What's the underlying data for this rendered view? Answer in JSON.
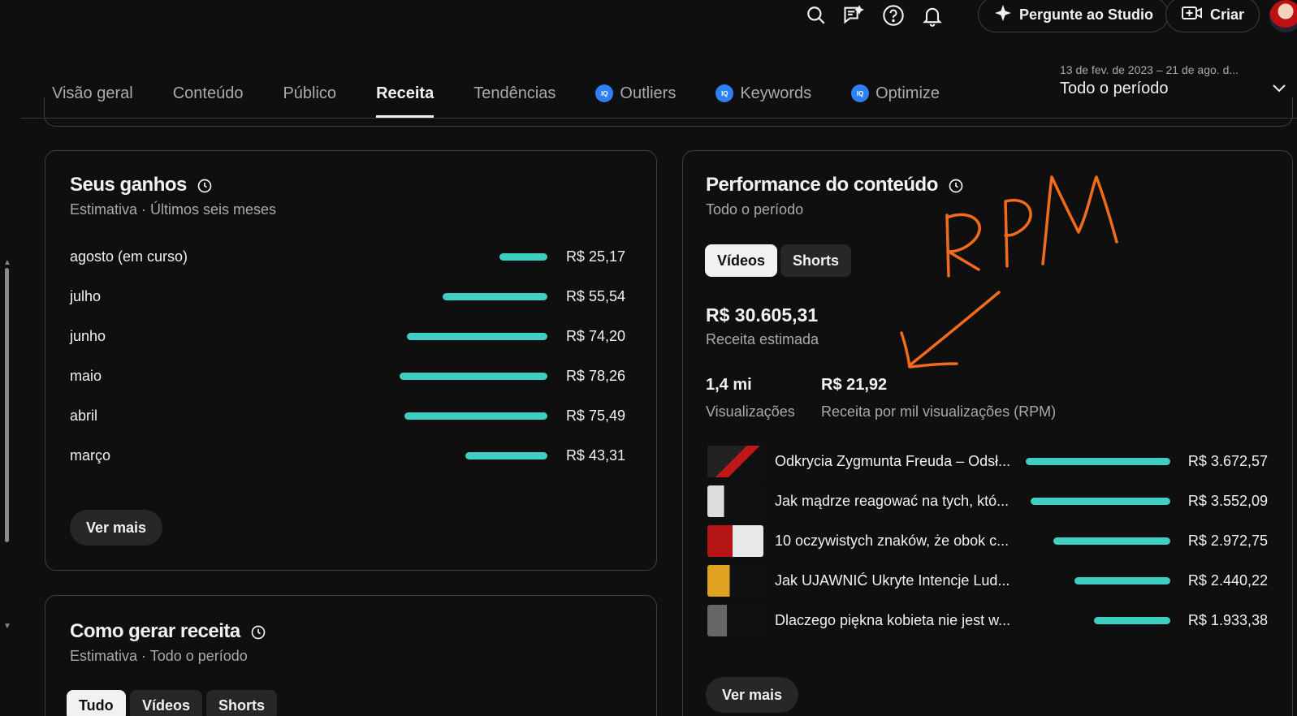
{
  "topbar": {
    "ask_studio_label": "Pergunte ao Studio",
    "create_label": "Criar"
  },
  "tabs": [
    {
      "label": "Visão geral"
    },
    {
      "label": "Conteúdo"
    },
    {
      "label": "Público"
    },
    {
      "label": "Receita",
      "active": true
    },
    {
      "label": "Tendências"
    },
    {
      "label": "Outliers",
      "badge": "IQ"
    },
    {
      "label": "Keywords",
      "badge": "IQ"
    },
    {
      "label": "Optimize",
      "badge": "IQ"
    }
  ],
  "date_range": {
    "range": "13 de fev. de 2023 – 21 de ago. d...",
    "period": "Todo o período"
  },
  "earnings": {
    "title": "Seus ganhos",
    "subtitle": "Estimativa · Últimos seis meses",
    "rows": [
      {
        "label": "agosto (em curso)",
        "value": "R$ 25,17",
        "amount": 25.17
      },
      {
        "label": "julho",
        "value": "R$ 55,54",
        "amount": 55.54
      },
      {
        "label": "junho",
        "value": "R$ 74,20",
        "amount": 74.2
      },
      {
        "label": "maio",
        "value": "R$ 78,26",
        "amount": 78.26
      },
      {
        "label": "abril",
        "value": "R$ 75,49",
        "amount": 75.49
      },
      {
        "label": "março",
        "value": "R$ 43,31",
        "amount": 43.31
      }
    ],
    "more_label": "Ver mais"
  },
  "how_to": {
    "title": "Como gerar receita",
    "subtitle": "Estimativa · Todo o período",
    "filters": [
      "Tudo",
      "Vídeos",
      "Shorts"
    ]
  },
  "performance": {
    "title": "Performance do conteúdo",
    "subtitle": "Todo o período",
    "toggle": [
      "Vídeos",
      "Shorts"
    ],
    "revenue_value": "R$ 30.605,31",
    "revenue_label": "Receita estimada",
    "views_value": "1,4 mi",
    "views_label": "Visualizações",
    "rpm_value": "R$ 21,92",
    "rpm_label": "Receita por mil visualizações (RPM)",
    "videos": [
      {
        "title": "Odkrycia Zygmunta Freuda – Odsł...",
        "value": "R$ 3.672,57",
        "amount": 3672.57
      },
      {
        "title": "Jak mądrze reagować na tych, któ...",
        "value": "R$ 3.552,09",
        "amount": 3552.09
      },
      {
        "title": "10 oczywistych znaków, że obok c...",
        "value": "R$ 2.972,75",
        "amount": 2972.75
      },
      {
        "title": "Jak UJAWNIĆ Ukryte Intencje Lud...",
        "value": "R$ 2.440,22",
        "amount": 2440.22
      },
      {
        "title": "Dlaczego piękna kobieta nie jest w...",
        "value": "R$ 1.933,38",
        "amount": 1933.38
      }
    ],
    "more_label": "Ver mais"
  },
  "annotation": {
    "text": "RPM",
    "color": "#f26b1d"
  },
  "colors": {
    "bar": "#3ecfc2",
    "background": "#0f0f0f",
    "accent_badge": "#2f7ff5"
  }
}
